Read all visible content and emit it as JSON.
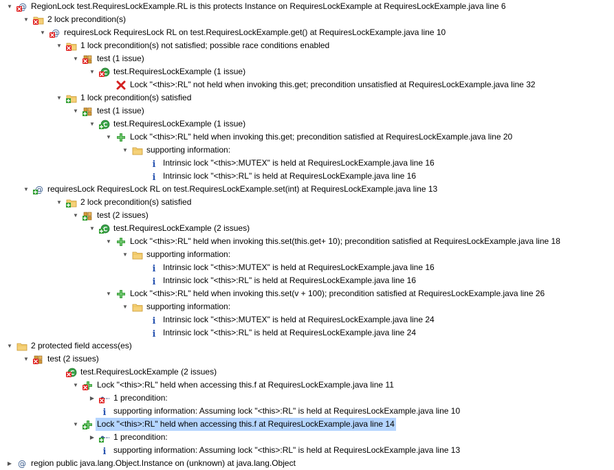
{
  "tree": {
    "rows": [
      {
        "label": "RegionLock test.RequiresLockExample.RL is this protects Instance  on  RequiresLockExample  at  RequiresLockExample.java line 6",
        "icon": "at-error-icon",
        "expanded": true
      },
      {
        "label": "2 lock precondition(s)",
        "icon": "folder-error-icon",
        "expanded": true
      },
      {
        "label": "requiresLock RequiresLock RL  on  test.RequiresLockExample.get()  at  RequiresLockExample.java line 10",
        "icon": "at-error-icon",
        "expanded": true
      },
      {
        "label": "1 lock precondition(s) not satisfied; possible race conditions enabled",
        "icon": "folder-error-icon",
        "expanded": true
      },
      {
        "label": "test (1 issue)",
        "icon": "package-error-icon",
        "expanded": true
      },
      {
        "label": "test.RequiresLockExample (1 issue)",
        "icon": "class-error-icon",
        "expanded": true
      },
      {
        "label": "Lock \"<this>:RL\" not held when invoking this.get; precondition unsatisfied  at  RequiresLockExample.java line 32",
        "icon": "red-x-icon",
        "expanded": null
      },
      {
        "label": "1 lock precondition(s) satisfied",
        "icon": "folder-ok-icon",
        "expanded": true
      },
      {
        "label": "test (1 issue)",
        "icon": "package-ok-icon",
        "expanded": true
      },
      {
        "label": "test.RequiresLockExample (1 issue)",
        "icon": "class-ok-icon",
        "expanded": true
      },
      {
        "label": "Lock \"<this>:RL\" held when invoking this.get; precondition satisfied  at  RequiresLockExample.java line 20",
        "icon": "green-plus-icon",
        "expanded": true
      },
      {
        "label": "supporting information:",
        "icon": "folder-icon",
        "expanded": true
      },
      {
        "label": "Intrinsic lock \"<this>:MUTEX\" is held  at  RequiresLockExample.java line 16",
        "icon": "info-icon",
        "expanded": null
      },
      {
        "label": "Intrinsic lock \"<this>:RL\" is held  at  RequiresLockExample.java line 16",
        "icon": "info-icon",
        "expanded": null
      },
      {
        "label": "requiresLock RequiresLock RL  on  test.RequiresLockExample.set(int)  at  RequiresLockExample.java line 13",
        "icon": "at-ok-icon",
        "expanded": true
      },
      {
        "label": "2 lock precondition(s) satisfied",
        "icon": "folder-ok-icon",
        "expanded": true
      },
      {
        "label": "test (2 issues)",
        "icon": "package-ok-icon",
        "expanded": true
      },
      {
        "label": "test.RequiresLockExample (2 issues)",
        "icon": "class-ok-icon",
        "expanded": true
      },
      {
        "label": "Lock \"<this>:RL\" held when invoking this.set(this.get+ 10); precondition satisfied  at  RequiresLockExample.java line 18",
        "icon": "green-plus-icon",
        "expanded": true
      },
      {
        "label": "supporting information:",
        "icon": "folder-icon",
        "expanded": true
      },
      {
        "label": "Intrinsic lock \"<this>:MUTEX\" is held  at  RequiresLockExample.java line 16",
        "icon": "info-icon",
        "expanded": null
      },
      {
        "label": "Intrinsic lock \"<this>:RL\" is held  at  RequiresLockExample.java line 16",
        "icon": "info-icon",
        "expanded": null
      },
      {
        "label": "Lock \"<this>:RL\" held when invoking this.set(v + 100); precondition satisfied  at  RequiresLockExample.java line 26",
        "icon": "green-plus-icon",
        "expanded": true
      },
      {
        "label": "supporting information:",
        "icon": "folder-icon",
        "expanded": true
      },
      {
        "label": "Intrinsic lock \"<this>:MUTEX\" is held  at  RequiresLockExample.java line 24",
        "icon": "info-icon",
        "expanded": null
      },
      {
        "label": "Intrinsic lock \"<this>:RL\" is held  at  RequiresLockExample.java line 24",
        "icon": "info-icon",
        "expanded": null
      },
      {
        "label": "2 protected field access(es)",
        "icon": "folder-icon",
        "expanded": true
      },
      {
        "label": "test (2 issues)",
        "icon": "package-error-icon",
        "expanded": true
      },
      {
        "label": "test.RequiresLockExample (2 issues)",
        "icon": "class-error-icon",
        "expanded": null
      },
      {
        "label": "Lock \"<this>:RL\" held when accessing this.f  at  RequiresLockExample.java line 11",
        "icon": "green-plus-error-icon",
        "expanded": true
      },
      {
        "label": "1 precondition:",
        "icon": "link-error-icon",
        "expanded": false
      },
      {
        "label": "supporting information: Assuming lock \"<this>:RL\" is held  at  RequiresLockExample.java line 10",
        "icon": "info-icon",
        "expanded": null
      },
      {
        "label": "Lock \"<this>:RL\" held when accessing this.f  at  RequiresLockExample.java line 14",
        "icon": "green-plus-ok-icon",
        "expanded": true,
        "selected": true
      },
      {
        "label": "1 precondition:",
        "icon": "link-ok-icon",
        "expanded": false
      },
      {
        "label": "supporting information: Assuming lock \"<this>:RL\" is held  at  RequiresLockExample.java line 13",
        "icon": "info-icon",
        "expanded": null
      },
      {
        "label": "region  public  java.lang.Object.Instance on (unknown)  at  java.lang.Object",
        "icon": "at-icon",
        "expanded": false
      }
    ]
  }
}
